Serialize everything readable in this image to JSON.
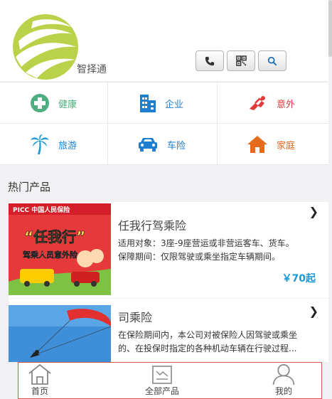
{
  "brand": {
    "name": "智择通"
  },
  "header": {
    "buttons": [
      {
        "icon": "phone-icon"
      },
      {
        "icon": "qrcode-icon"
      },
      {
        "icon": "search-icon"
      }
    ]
  },
  "categories": [
    {
      "label": "健康",
      "color": "#4fae80",
      "icon": "plus-cross-icon"
    },
    {
      "label": "企业",
      "color": "#1e7fd0",
      "icon": "building-icon"
    },
    {
      "label": "意外",
      "color": "#e23a3a",
      "icon": "fall-icon"
    },
    {
      "label": "旅游",
      "color": "#1e7fd0",
      "icon": "palm-tree-icon"
    },
    {
      "label": "车险",
      "color": "#1e7fd0",
      "icon": "car-icon"
    },
    {
      "label": "家庭",
      "color": "#e56a1c",
      "icon": "home-icon"
    }
  ],
  "section": {
    "title": "热门产品"
  },
  "products": [
    {
      "title": "任我行驾乘险",
      "desc1": "适用对象：3座-9座营运或非营运客车、货车。",
      "desc2": "保障期间：仅限驾驶或乘坐指定车辆期间。",
      "price": "￥70起",
      "image": {
        "brand_text": "PICC 中国人民保险",
        "headline": "“任我行”",
        "subhead": "驾乘人员意外险"
      }
    },
    {
      "title": "司乘险",
      "desc1": "在保险期间内，本公司对被保险人因驾驶或乘坐",
      "desc2": "的、在投保时指定的各种机动车辆在行驶过程...",
      "price": ""
    }
  ],
  "tabbar": {
    "tabs": [
      {
        "label": "首页"
      },
      {
        "label": "全部产品"
      },
      {
        "label": "我的"
      }
    ]
  }
}
